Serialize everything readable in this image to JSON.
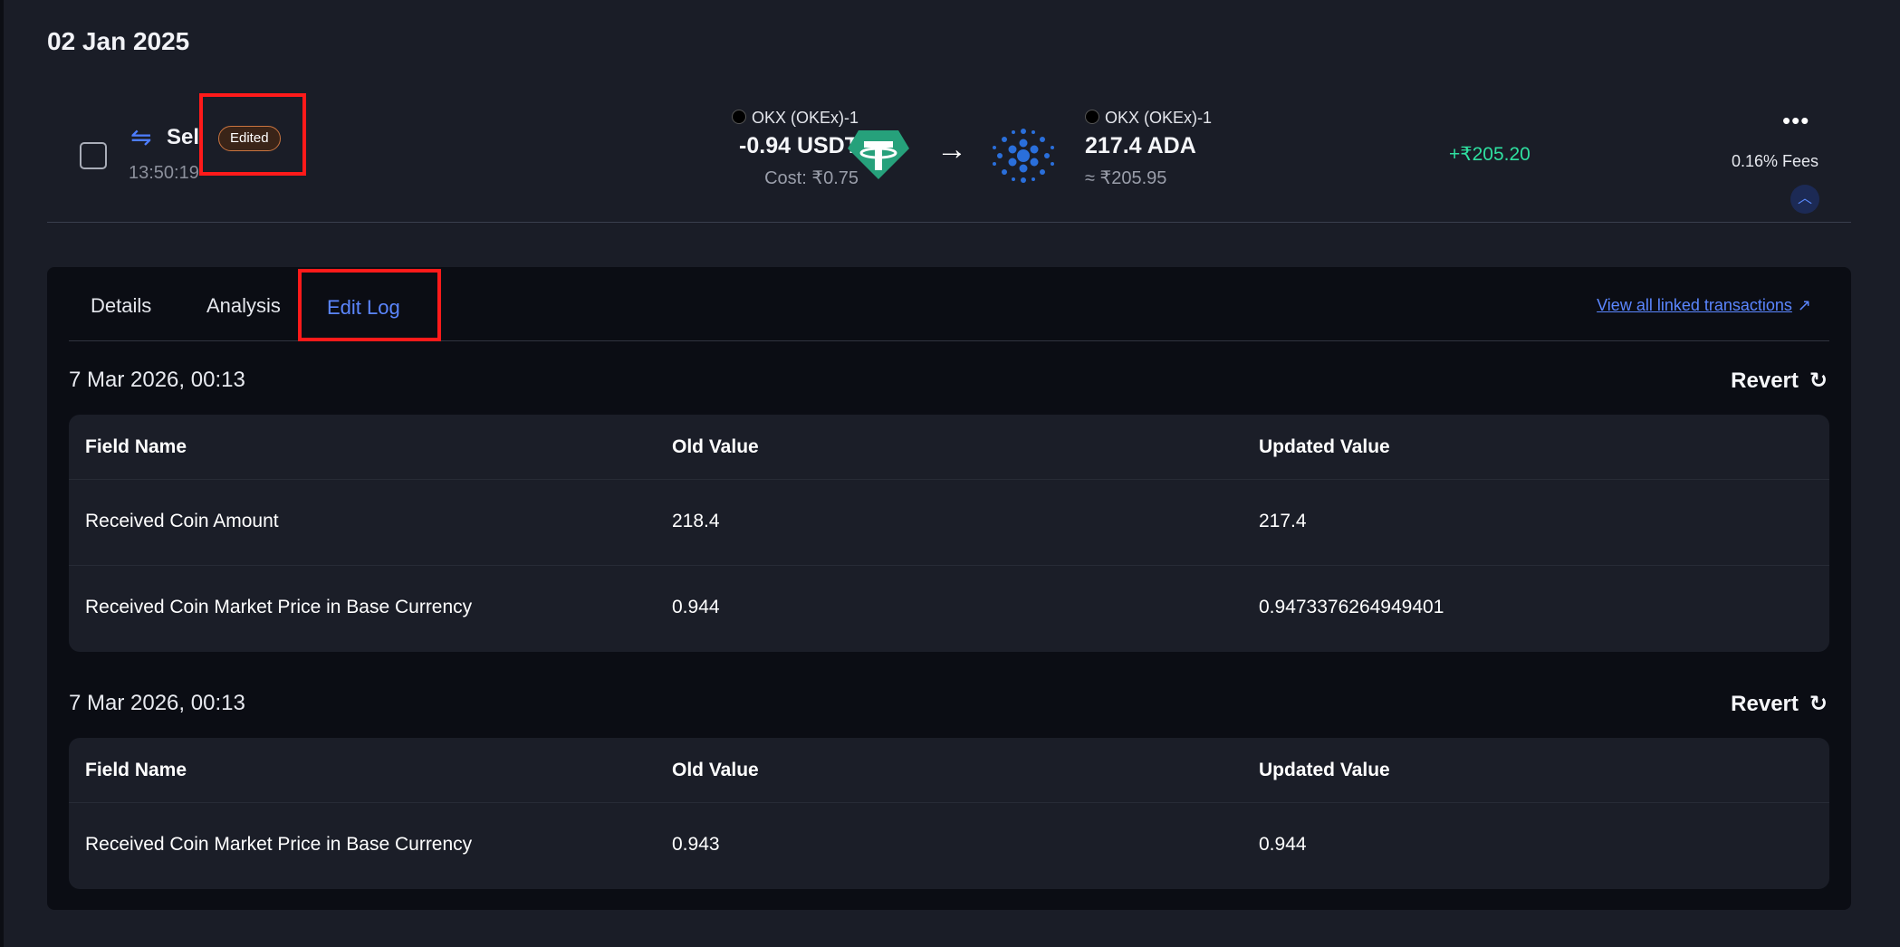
{
  "date_header": "02 Jan 2025",
  "transaction": {
    "type_label": "Sell",
    "time": "13:50:19",
    "edited_badge": "Edited",
    "sent": {
      "exchange": "OKX (OKEx)-1",
      "amount": "-0.94 USDT",
      "cost": "Cost: ₹0.75",
      "coin_icon": "tether-usdt-icon"
    },
    "received": {
      "exchange": "OKX (OKEx)-1",
      "amount": "217.4 ADA",
      "value": "≈ ₹205.95",
      "coin_icon": "cardano-ada-icon"
    },
    "pnl": "+₹205.20",
    "fees": "0.16% Fees"
  },
  "tabs": [
    {
      "label": "Details",
      "active": false
    },
    {
      "label": "Analysis",
      "active": false
    },
    {
      "label": "Edit Log",
      "active": true
    }
  ],
  "view_linked_label": "View all linked transactions",
  "edit_log": {
    "columns": [
      "Field Name",
      "Old Value",
      "Updated Value"
    ],
    "revert_label": "Revert",
    "entries": [
      {
        "date": "7 Mar 2026, 00:13",
        "rows": [
          [
            "Received Coin Amount",
            "218.4",
            "217.4"
          ],
          [
            "Received Coin Market Price in Base Currency",
            "0.944",
            "0.9473376264949401"
          ]
        ]
      },
      {
        "date": "7 Mar 2026, 00:13",
        "rows": [
          [
            "Received Coin Market Price in Base Currency",
            "0.943",
            "0.944"
          ]
        ]
      }
    ]
  },
  "colors": {
    "background": "#1a1d27",
    "panel": "#0b0d14",
    "accent_blue": "#5b86ff",
    "profit_green": "#2fe0a0",
    "highlight_red": "#ff1a1a",
    "usdt_teal": "#26a17b",
    "ada_blue": "#2a6fdb"
  }
}
